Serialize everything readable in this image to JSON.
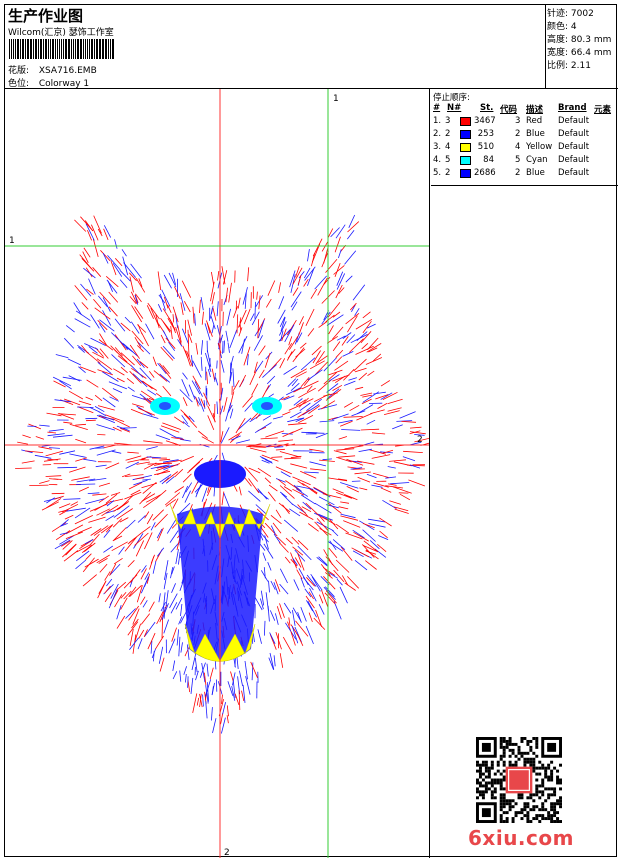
{
  "header": {
    "title": "生产作业图",
    "software": "Wilcom(汇京) 瑟饰工作室",
    "file_label": "花版:",
    "file_name": "XSA716.EMB",
    "colorway_label": "色位:",
    "colorway": "Colorway 1"
  },
  "stats": [
    {
      "label": "针迹:",
      "value": "7002"
    },
    {
      "label": "颜色:",
      "value": "4"
    },
    {
      "label": "高度:",
      "value": "80.3 mm"
    },
    {
      "label": "宽度:",
      "value": "66.4 mm"
    },
    {
      "label": "比例:",
      "value": "2.11"
    }
  ],
  "legend": {
    "title": "停止顺序:",
    "headers": {
      "num": "#",
      "n": "N#",
      "st": "St.",
      "code": "代码",
      "desc": "描述",
      "brand": "Brand",
      "element": "元素"
    },
    "rows": [
      {
        "num": "1.",
        "n": "3",
        "color": "#ff0000",
        "st": "3467",
        "code": "3",
        "desc": "Red",
        "brand": "Default"
      },
      {
        "num": "2.",
        "n": "2",
        "color": "#0000ff",
        "st": "253",
        "code": "2",
        "desc": "Blue",
        "brand": "Default"
      },
      {
        "num": "3.",
        "n": "4",
        "color": "#ffff00",
        "st": "510",
        "code": "4",
        "desc": "Yellow",
        "brand": "Default"
      },
      {
        "num": "4.",
        "n": "5",
        "color": "#00ffff",
        "st": "84",
        "code": "5",
        "desc": "Cyan",
        "brand": "Default"
      },
      {
        "num": "5.",
        "n": "2",
        "color": "#0000ff",
        "st": "2686",
        "code": "2",
        "desc": "Blue",
        "brand": "Default"
      }
    ]
  },
  "guides": {
    "v1_label": "1",
    "v2_label": "2",
    "h1_label": "1",
    "h2_label": "2",
    "v_red_color": "#ff3333",
    "v_green_color": "#33cc33"
  },
  "watermark": "6xiu.com"
}
